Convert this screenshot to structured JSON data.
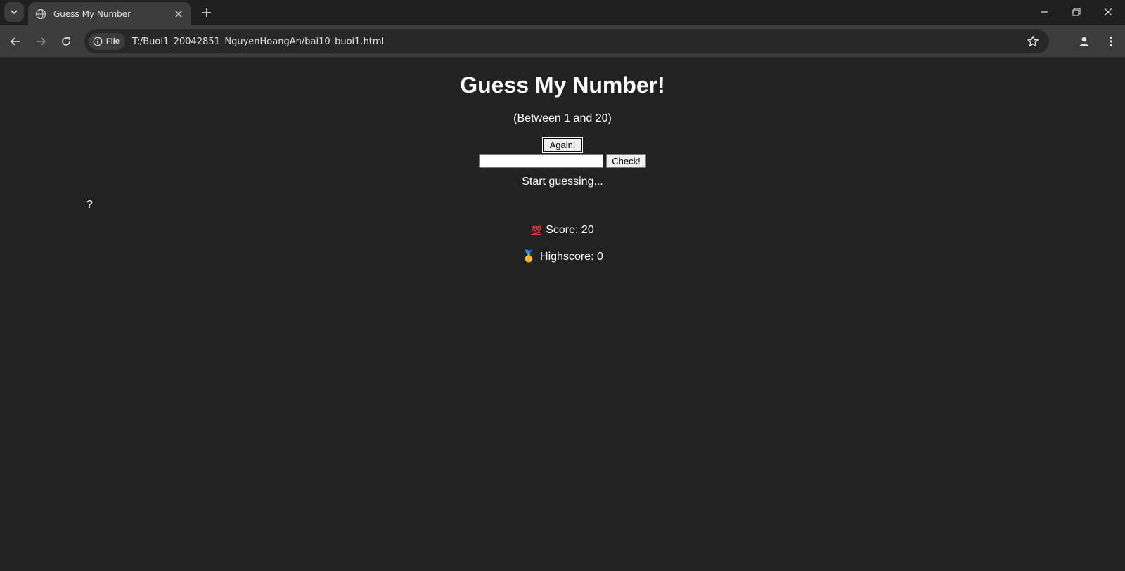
{
  "browser": {
    "tab_title": "Guess My Number",
    "url_chip": "File",
    "url": "T:/Buoi1_20042851_NguyenHoangAn/bai10_buoi1.html"
  },
  "game": {
    "title": "Guess My Number!",
    "range_text": "(Between 1 and 20)",
    "again_label": "Again!",
    "guess_value": "",
    "check_label": "Check!",
    "message": "Start guessing...",
    "secret_number": "?",
    "score_emoji": "💯",
    "score_text": "Score: 20",
    "highscore_emoji": "🥇",
    "highscore_text": "Highscore: 0"
  }
}
